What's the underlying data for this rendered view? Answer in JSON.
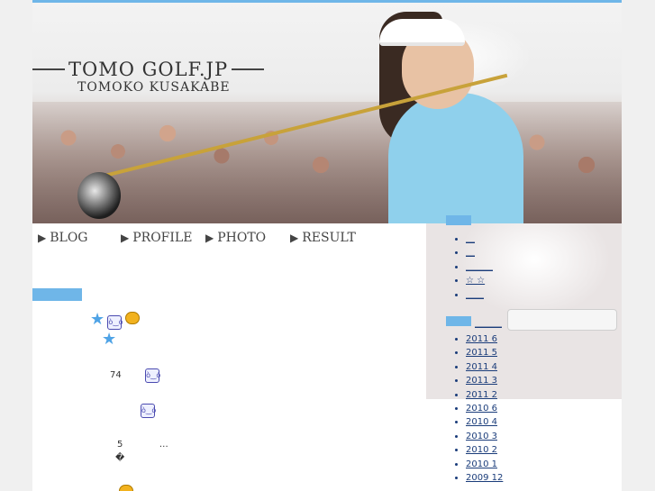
{
  "site": {
    "title": "TOMO GOLF.JP",
    "subtitle": "TOMOKO KUSAKABE"
  },
  "nav": [
    {
      "label": "BLOG"
    },
    {
      "label": "PROFILE"
    },
    {
      "label": "PHOTO"
    },
    {
      "label": "RESULT"
    }
  ],
  "content": {
    "line_a": "74",
    "line_b": "5",
    "line_b_tail": "…",
    "line_c": "�"
  },
  "sidebar": {
    "links": [
      "＿",
      "＿",
      "＿＿＿",
      "☆ ☆",
      "＿＿"
    ],
    "archive_heading": "＿＿＿",
    "archives": [
      "2011 6",
      "2011 5",
      "2011 4",
      "2011 3",
      "2011 2",
      "2010 6",
      "2010 4",
      "2010 3",
      "2010 2",
      "2010 1",
      "2009 12"
    ]
  },
  "colors": {
    "accent": "#6fb6e8",
    "link": "#1a3c7a"
  }
}
